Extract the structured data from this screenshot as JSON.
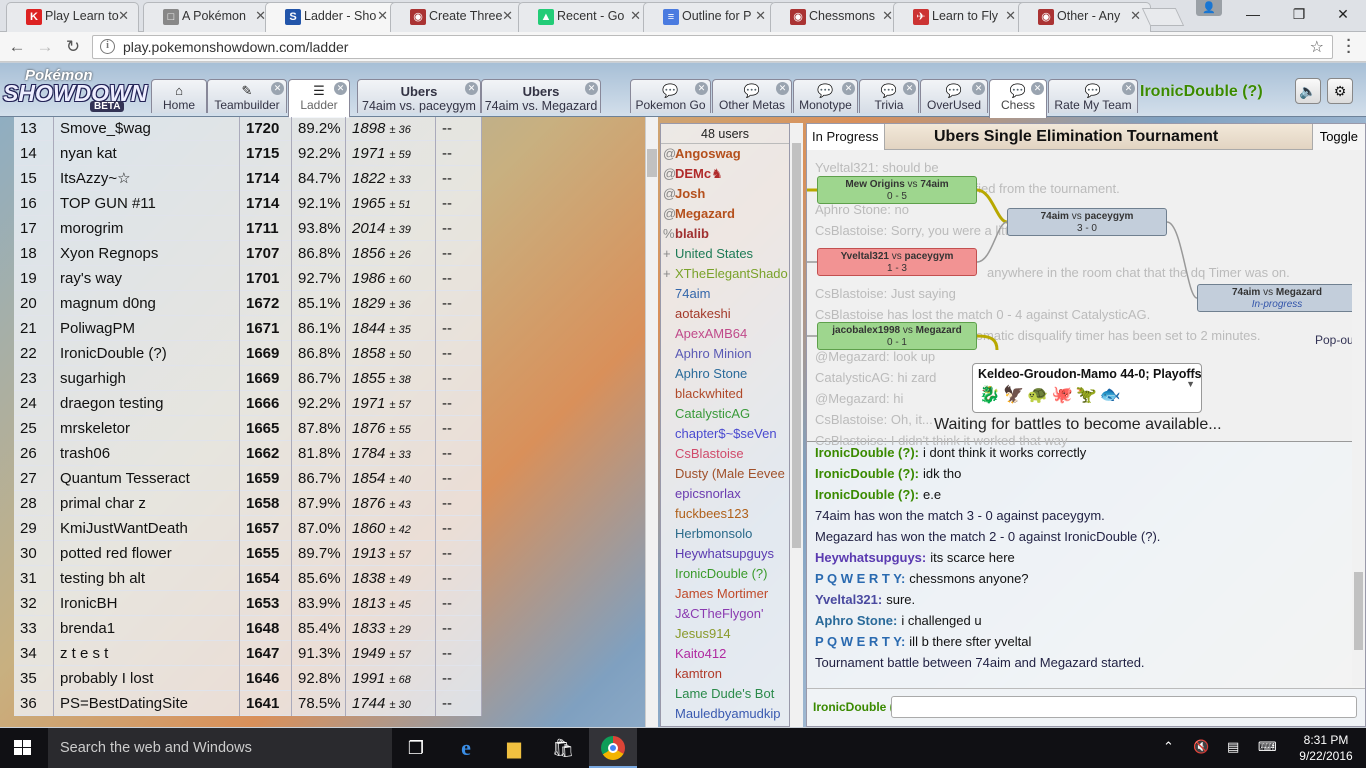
{
  "browser": {
    "tabs": [
      {
        "title": "Play Learn to",
        "icon": "K",
        "color": "#d22"
      },
      {
        "title": "A Pokémon",
        "icon": "□",
        "color": "#888"
      },
      {
        "title": "Ladder - Sho",
        "icon": "S",
        "color": "#2255aa"
      },
      {
        "title": "Create Three",
        "icon": "◉",
        "color": "#a33"
      },
      {
        "title": "Recent - Go",
        "icon": "▲",
        "color": "#2c7"
      },
      {
        "title": "Outline for P",
        "icon": "≡",
        "color": "#4a7be0"
      },
      {
        "title": "Chessmons",
        "icon": "◉",
        "color": "#a33"
      },
      {
        "title": "Learn to Fly",
        "icon": "✈",
        "color": "#c33"
      },
      {
        "title": "Other - Any",
        "icon": "◉",
        "color": "#a33"
      }
    ],
    "url": "play.pokemonshowdown.com/ladder"
  },
  "logo": {
    "line1": "Pokémon",
    "line2": "SHOWDOWN",
    "badge": "BETA"
  },
  "nav": {
    "home": "Home",
    "teambuilder": "Teambuilder",
    "ladder": "Ladder",
    "battle1_title": "Ubers",
    "battle1_sub": "74aim vs. paceygym",
    "battle2_title": "Ubers",
    "battle2_sub": "74aim vs. Megazard",
    "rooms": [
      "Pokemon Go",
      "Other Metas",
      "Monotype",
      "Trivia",
      "OverUsed",
      "Chess",
      "Rate My Team"
    ]
  },
  "user": {
    "name": "IronicDouble (?)"
  },
  "ladder": [
    {
      "rank": "13",
      "name": "Smove_$wag",
      "elo": "1720",
      "gxe": "89.2%",
      "glicko": "1898",
      "dev": "± 36",
      "coil": "--"
    },
    {
      "rank": "14",
      "name": "nyan kat",
      "elo": "1715",
      "gxe": "92.2%",
      "glicko": "1971",
      "dev": "± 59",
      "coil": "--"
    },
    {
      "rank": "15",
      "name": "ItsAzzy~☆",
      "elo": "1714",
      "gxe": "84.7%",
      "glicko": "1822",
      "dev": "± 33",
      "coil": "--"
    },
    {
      "rank": "16",
      "name": "TOP GUN #11",
      "elo": "1714",
      "gxe": "92.1%",
      "glicko": "1965",
      "dev": "± 51",
      "coil": "--"
    },
    {
      "rank": "17",
      "name": "morogrim",
      "elo": "1711",
      "gxe": "93.8%",
      "glicko": "2014",
      "dev": "± 39",
      "coil": "--"
    },
    {
      "rank": "18",
      "name": "Xyon Regnops",
      "elo": "1707",
      "gxe": "86.8%",
      "glicko": "1856",
      "dev": "± 26",
      "coil": "--"
    },
    {
      "rank": "19",
      "name": "ray's way",
      "elo": "1701",
      "gxe": "92.7%",
      "glicko": "1986",
      "dev": "± 60",
      "coil": "--"
    },
    {
      "rank": "20",
      "name": "magnum d0ng",
      "elo": "1672",
      "gxe": "85.1%",
      "glicko": "1829",
      "dev": "± 36",
      "coil": "--"
    },
    {
      "rank": "21",
      "name": "PoliwagPM",
      "elo": "1671",
      "gxe": "86.1%",
      "glicko": "1844",
      "dev": "± 35",
      "coil": "--"
    },
    {
      "rank": "22",
      "name": "IronicDouble (?)",
      "elo": "1669",
      "gxe": "86.8%",
      "glicko": "1858",
      "dev": "± 50",
      "coil": "--"
    },
    {
      "rank": "23",
      "name": "sugarhigh",
      "elo": "1669",
      "gxe": "86.7%",
      "glicko": "1855",
      "dev": "± 38",
      "coil": "--"
    },
    {
      "rank": "24",
      "name": "draegon testing",
      "elo": "1666",
      "gxe": "92.2%",
      "glicko": "1971",
      "dev": "± 57",
      "coil": "--"
    },
    {
      "rank": "25",
      "name": "mrskeletor",
      "elo": "1665",
      "gxe": "87.8%",
      "glicko": "1876",
      "dev": "± 55",
      "coil": "--"
    },
    {
      "rank": "26",
      "name": "trash06",
      "elo": "1662",
      "gxe": "81.8%",
      "glicko": "1784",
      "dev": "± 33",
      "coil": "--"
    },
    {
      "rank": "27",
      "name": "Quantum Tesseract",
      "elo": "1659",
      "gxe": "86.7%",
      "glicko": "1854",
      "dev": "± 40",
      "coil": "--"
    },
    {
      "rank": "28",
      "name": "primal char z",
      "elo": "1658",
      "gxe": "87.9%",
      "glicko": "1876",
      "dev": "± 43",
      "coil": "--"
    },
    {
      "rank": "29",
      "name": "KmiJustWantDeath",
      "elo": "1657",
      "gxe": "87.0%",
      "glicko": "1860",
      "dev": "± 42",
      "coil": "--"
    },
    {
      "rank": "30",
      "name": "potted red flower",
      "elo": "1655",
      "gxe": "89.7%",
      "glicko": "1913",
      "dev": "± 57",
      "coil": "--"
    },
    {
      "rank": "31",
      "name": "testing bh alt",
      "elo": "1654",
      "gxe": "85.6%",
      "glicko": "1838",
      "dev": "± 49",
      "coil": "--"
    },
    {
      "rank": "32",
      "name": "IronicBH",
      "elo": "1653",
      "gxe": "83.9%",
      "glicko": "1813",
      "dev": "± 45",
      "coil": "--"
    },
    {
      "rank": "33",
      "name": "brenda1",
      "elo": "1648",
      "gxe": "85.4%",
      "glicko": "1833",
      "dev": "± 29",
      "coil": "--"
    },
    {
      "rank": "34",
      "name": "z t e s t",
      "elo": "1647",
      "gxe": "91.3%",
      "glicko": "1949",
      "dev": "± 57",
      "coil": "--"
    },
    {
      "rank": "35",
      "name": "probably I lost",
      "elo": "1646",
      "gxe": "92.8%",
      "glicko": "1991",
      "dev": "± 68",
      "coil": "--"
    },
    {
      "rank": "36",
      "name": "PS=BestDatingSite",
      "elo": "1641",
      "gxe": "78.5%",
      "glicko": "1744",
      "dev": "± 30",
      "coil": "--"
    }
  ],
  "userlist": {
    "count": "48 users",
    "users": [
      {
        "g": "@",
        "n": "Angoswag",
        "c": "#b5501c",
        "b": true
      },
      {
        "g": "@",
        "n": "DEMc♞",
        "c": "#b02a2a",
        "b": true
      },
      {
        "g": "@",
        "n": "Josh",
        "c": "#b5501c",
        "b": true
      },
      {
        "g": "@",
        "n": "Megazard",
        "c": "#b5501c",
        "b": true
      },
      {
        "g": "%",
        "n": "blalib",
        "c": "#a03030",
        "b": true
      },
      {
        "g": "+",
        "n": "United States",
        "c": "#1c7a55",
        "b": false
      },
      {
        "g": "+",
        "n": "XTheElegantShado",
        "c": "#7aa22a",
        "b": false
      },
      {
        "g": "",
        "n": "74aim",
        "c": "#3366aa",
        "b": false
      },
      {
        "g": "",
        "n": "aotakeshi",
        "c": "#a33a2a",
        "b": false
      },
      {
        "g": "",
        "n": "ApexAMB64",
        "c": "#c04a8a",
        "b": false
      },
      {
        "g": "",
        "n": "Aphro Minion",
        "c": "#5a5ab5",
        "b": false
      },
      {
        "g": "",
        "n": "Aphro Stone",
        "c": "#2a6a9a",
        "b": false
      },
      {
        "g": "",
        "n": "blackwhited",
        "c": "#b04a2a",
        "b": false
      },
      {
        "g": "",
        "n": "CatalysticAG",
        "c": "#3a9a3a",
        "b": false
      },
      {
        "g": "",
        "n": "chapter$~$seVen",
        "c": "#4a4ad0",
        "b": false
      },
      {
        "g": "",
        "n": "CsBlastoise",
        "c": "#d04a6a",
        "b": false
      },
      {
        "g": "",
        "n": "Dusty (Male Eevee",
        "c": "#a0502a",
        "b": false
      },
      {
        "g": "",
        "n": "epicsnorlax",
        "c": "#6a3ab0",
        "b": false
      },
      {
        "g": "",
        "n": "fuckbees123",
        "c": "#b0601a",
        "b": false
      },
      {
        "g": "",
        "n": "Herbmonsolo",
        "c": "#2a6a8a",
        "b": false
      },
      {
        "g": "",
        "n": "Heywhatsupguys",
        "c": "#5a3ab0",
        "b": false
      },
      {
        "g": "",
        "n": "IronicDouble (?)",
        "c": "#3a9a2a",
        "b": false
      },
      {
        "g": "",
        "n": "James Mortimer",
        "c": "#c04a2a",
        "b": false
      },
      {
        "g": "",
        "n": "J&CTheFlygon'",
        "c": "#8a3ab0",
        "b": false
      },
      {
        "g": "",
        "n": "Jesus914",
        "c": "#8a9a2a",
        "b": false
      },
      {
        "g": "",
        "n": "Kaito412",
        "c": "#b02aa0",
        "b": false
      },
      {
        "g": "",
        "n": "kamtron",
        "c": "#b03a2a",
        "b": false
      },
      {
        "g": "",
        "n": "Lame Dude's Bot",
        "c": "#2a8a4a",
        "b": false
      },
      {
        "g": "",
        "n": "Mauledbyamudkip",
        "c": "#3a5ab0",
        "b": false
      }
    ]
  },
  "tournament": {
    "status": "In Progress",
    "title": "Ubers Single Elimination Tournament",
    "toggle": "Toggle",
    "popout": "Pop-out",
    "waiting": "Waiting for battles to become available...",
    "team_name": "Keldeo-Groudon-Mamo 44-0; Playoffs",
    "team_sprites": "🐉🦅🐢🐙🦖🐟",
    "nodes": {
      "n1_p1": "Mew Origins",
      "n1_vs": "vs",
      "n1_p2": "74aim",
      "n1_score": "0 - 5",
      "n2_p1": "Yveltal321",
      "n2_vs": "vs",
      "n2_p2": "paceygym",
      "n2_score": "1 - 3",
      "n3_p1": "jacobalex1998",
      "n3_vs": "vs",
      "n3_p2": "Megazard",
      "n3_score": "0 - 1",
      "n4_p1": "74aim",
      "n4_vs": "vs",
      "n4_p2": "paceygym",
      "n4_score": "3 - 0",
      "n5_p1": "74aim",
      "n5_vs": "vs",
      "n5_p2": "Megazard",
      "n5_status": "In-progress"
    },
    "ghost_lines": [
      "Yveltal321: should be",
      "qualified from the tournament.",
      "Aphro Stone: no",
      "CsBlastoise: Sorry, you were a little too..",
      "anywhere in the room chat that the dq Timer was on.",
      "CsBlastoise: Just saying",
      "CsBlastoise has lost the match 0 - 4 against CatalysticAG.",
      "ent's automatic disqualify timer has been set to 2 minutes.",
      "@Megazard: look up",
      "CatalysticAG: hi zard",
      "@Megazard: hi",
      "CsBlastoise: Oh, it...",
      "CsBlastoise: I didn't think it worked that way"
    ]
  },
  "chat": [
    {
      "u": "IronicDouble (?):",
      "t": "i dont think it works correctly",
      "c": "#3a8a00"
    },
    {
      "u": "IronicDouble (?):",
      "t": "idk tho",
      "c": "#3a8a00"
    },
    {
      "u": "IronicDouble (?):",
      "t": "e.e",
      "c": "#3a8a00"
    },
    {
      "u": "",
      "t": "74aim has won the match 3 - 0 against paceygym.",
      "c": ""
    },
    {
      "u": "",
      "t": "Megazard has won the match 2 - 0 against IronicDouble (?).",
      "c": ""
    },
    {
      "u": "Heywhatsupguys:",
      "t": "its scarce here",
      "c": "#5a3ab0"
    },
    {
      "u": "P Q W E R T Y:",
      "t": "chessmons anyone?",
      "c": "#2a6ab0"
    },
    {
      "u": "Yveltal321:",
      "t": "sure.",
      "c": "#4a4aa0"
    },
    {
      "u": "Aphro Stone:",
      "t": "i challenged u",
      "c": "#2a6a9a"
    },
    {
      "u": "P Q W E R T Y:",
      "t": "ill b there sfter yveltal",
      "c": "#2a6ab0"
    },
    {
      "u": "",
      "t": "Tournament battle between 74aim and Megazard started.",
      "c": ""
    }
  ],
  "chat_input": {
    "name": "IronicDouble (?)"
  },
  "taskbar": {
    "search": "Search the web and Windows",
    "time": "8:31 PM",
    "date": "9/22/2016"
  },
  "colors": {
    "accent_green": "#3a8a00",
    "bracket_win": "#9ed68e",
    "bracket_loss": "#f29393"
  }
}
